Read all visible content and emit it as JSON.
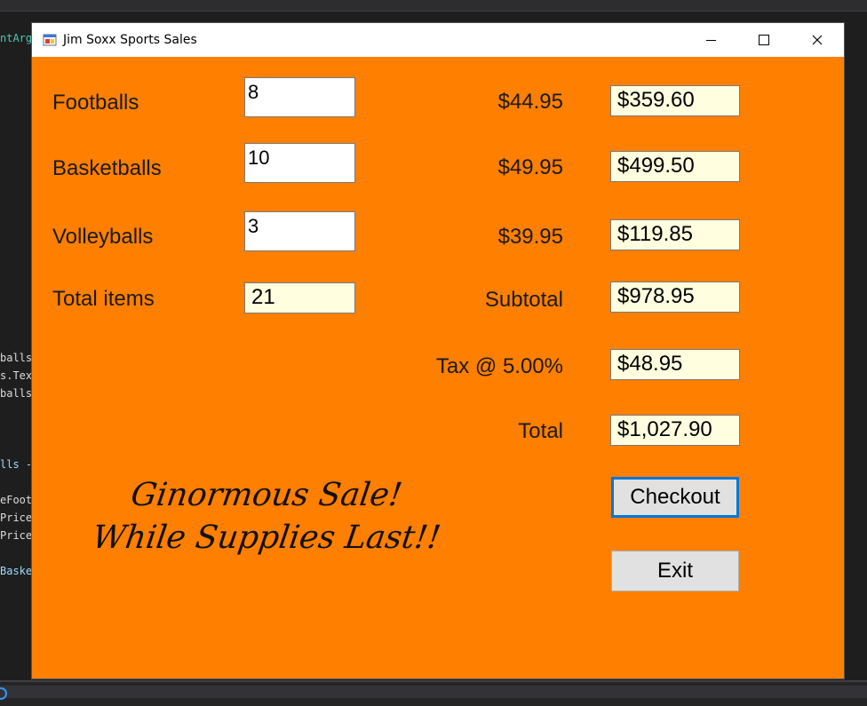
{
  "editor": {
    "code_fragments": [
      {
        "text": "ntArg",
        "color": "teal"
      },
      {
        "text": "balls",
        "color": "plain"
      },
      {
        "text": "s.Tex",
        "color": "plain"
      },
      {
        "text": "balls",
        "color": "plain"
      },
      {
        "text": "lls -",
        "color": "blue"
      },
      {
        "text": "eFoot",
        "color": "plain"
      },
      {
        "text": "Price",
        "color": "plain"
      },
      {
        "text": "Price",
        "color": "plain"
      },
      {
        "text": "Baske",
        "color": "blue"
      }
    ]
  },
  "window": {
    "title": "Jim Soxx Sports Sales",
    "controls": {
      "minimize": "minimize-icon",
      "maximize": "maximize-icon",
      "close": "close-icon"
    },
    "background_color": "#ff7f00"
  },
  "items": [
    {
      "label": "Footballs",
      "quantity": "8",
      "price": "$44.95",
      "line_total": "$359.60"
    },
    {
      "label": "Basketballs",
      "quantity": "10",
      "price": "$49.95",
      "line_total": "$499.50"
    },
    {
      "label": "Volleyballs",
      "quantity": "3",
      "price": "$39.95",
      "line_total": "$119.85"
    }
  ],
  "summary": {
    "total_items_label": "Total items",
    "total_items_value": "21",
    "subtotal_label": "Subtotal",
    "subtotal_value": "$978.95",
    "tax_label": "Tax @ 5.00%",
    "tax_value": "$48.95",
    "total_label": "Total",
    "total_value": "$1,027.90"
  },
  "buttons": {
    "checkout": "Checkout",
    "exit": "Exit"
  },
  "promo": {
    "line1": "Ginormous Sale!",
    "line2": "While Supplies Last!!"
  }
}
